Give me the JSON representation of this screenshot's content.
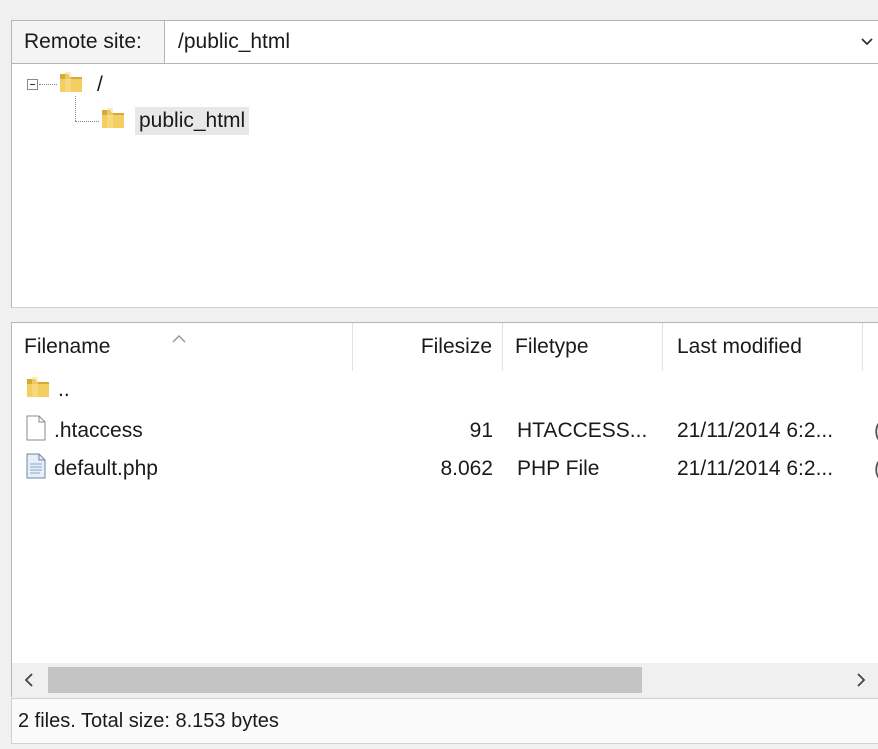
{
  "address_bar": {
    "label": "Remote site:",
    "path": "/public_html",
    "dropdown_icon": "chevron-down-icon"
  },
  "tree": {
    "root": {
      "label": "/",
      "icon": "folder-icon",
      "expanded": true
    },
    "child": {
      "label": "public_html",
      "icon": "folder-icon",
      "selected": true
    }
  },
  "file_list": {
    "columns": {
      "filename": "Filename",
      "filesize": "Filesize",
      "filetype": "Filetype",
      "last_modified": "Last modified"
    },
    "rows": [
      {
        "name": "..",
        "size": "",
        "type": "",
        "modified": "",
        "extra": "",
        "icon": "folder-icon"
      },
      {
        "name": ".htaccess",
        "size": "91",
        "type": "HTACCESS...",
        "modified": "21/11/2014 6:2...",
        "extra": "(",
        "icon": "file-icon"
      },
      {
        "name": "default.php",
        "size": "8.062",
        "type": "PHP File",
        "modified": "21/11/2014 6:2...",
        "extra": "(",
        "icon": "php-file-icon"
      }
    ]
  },
  "scrollbar": {
    "position_fraction": 0.0,
    "visible_fraction": 0.7
  },
  "status": {
    "text": "2 files. Total size: 8.153 bytes"
  },
  "colors": {
    "folder": "#e8c14a",
    "selection": "#e8e8e8",
    "border": "#b5b5b5"
  }
}
